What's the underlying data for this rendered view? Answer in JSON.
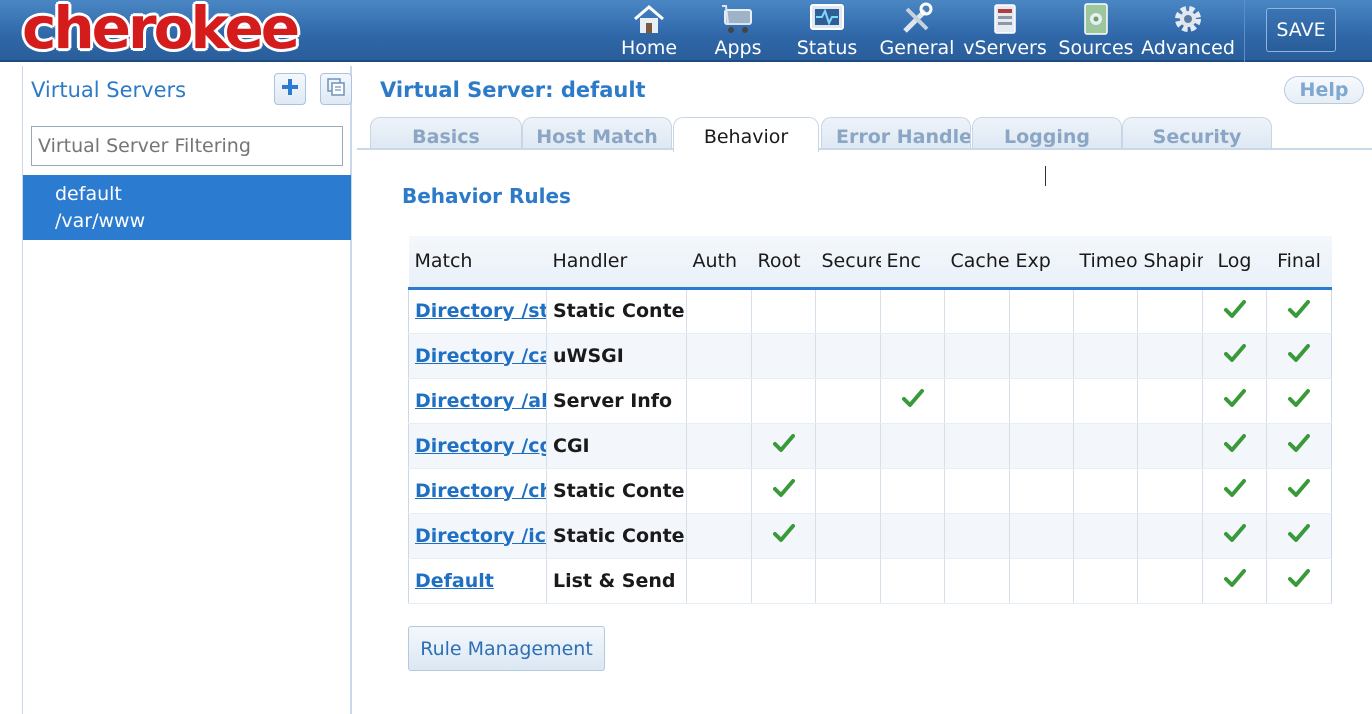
{
  "app": {
    "logo_text": "cherokee",
    "save_label": "SAVE"
  },
  "nav": [
    {
      "label": "Home",
      "icon": "home-icon"
    },
    {
      "label": "Apps",
      "icon": "apps-cart-icon"
    },
    {
      "label": "Status",
      "icon": "status-monitor-icon"
    },
    {
      "label": "General",
      "icon": "general-tools-icon"
    },
    {
      "label": "vServers",
      "icon": "vservers-icon"
    },
    {
      "label": "Sources",
      "icon": "sources-icon"
    },
    {
      "label": "Advanced",
      "icon": "advanced-gear-icon"
    }
  ],
  "sidebar": {
    "title": "Virtual Servers",
    "filter_placeholder": "Virtual Server Filtering",
    "items": [
      {
        "name": "default",
        "path": "/var/www"
      }
    ]
  },
  "main": {
    "title": "Virtual Server: default",
    "help_label": "Help",
    "tabs": [
      "Basics",
      "Host Match",
      "Behavior",
      "Error Handler",
      "Logging",
      "Security"
    ],
    "active_tab": "Behavior",
    "section_title": "Behavior Rules",
    "columns": [
      "Match",
      "Handler",
      "Auth",
      "Root",
      "Secure",
      "Enc",
      "Cache",
      "Exp",
      "Timeout",
      "Shaping",
      "Log",
      "Final"
    ],
    "rows": [
      {
        "match": "Directory /static",
        "handler": "Static Content",
        "flags": [
          false,
          false,
          false,
          false,
          false,
          false,
          false,
          false,
          true,
          true
        ]
      },
      {
        "match": "Directory /cache",
        "handler": "uWSGI",
        "flags": [
          false,
          false,
          false,
          false,
          false,
          false,
          false,
          false,
          true,
          true
        ]
      },
      {
        "match": "Directory /about",
        "handler": "Server Info",
        "flags": [
          false,
          false,
          false,
          true,
          false,
          false,
          false,
          false,
          true,
          true
        ]
      },
      {
        "match": "Directory /cgi-bin",
        "handler": "CGI",
        "flags": [
          false,
          true,
          false,
          false,
          false,
          false,
          false,
          false,
          true,
          true
        ]
      },
      {
        "match": "Directory /cherokee_themes",
        "handler": "Static Content",
        "flags": [
          false,
          true,
          false,
          false,
          false,
          false,
          false,
          false,
          true,
          true
        ]
      },
      {
        "match": "Directory /icons",
        "handler": "Static Content",
        "flags": [
          false,
          true,
          false,
          false,
          false,
          false,
          false,
          false,
          true,
          true
        ]
      },
      {
        "match": "Default",
        "handler": "List & Send",
        "flags": [
          false,
          false,
          false,
          false,
          false,
          false,
          false,
          false,
          true,
          true
        ]
      }
    ],
    "rule_management_label": "Rule Management"
  },
  "colors": {
    "accent": "#2d7ac8",
    "selected": "#2b7bd0",
    "check": "#3a9a3a",
    "topbar": "#2f67a8",
    "logo": "#d41c1c"
  }
}
